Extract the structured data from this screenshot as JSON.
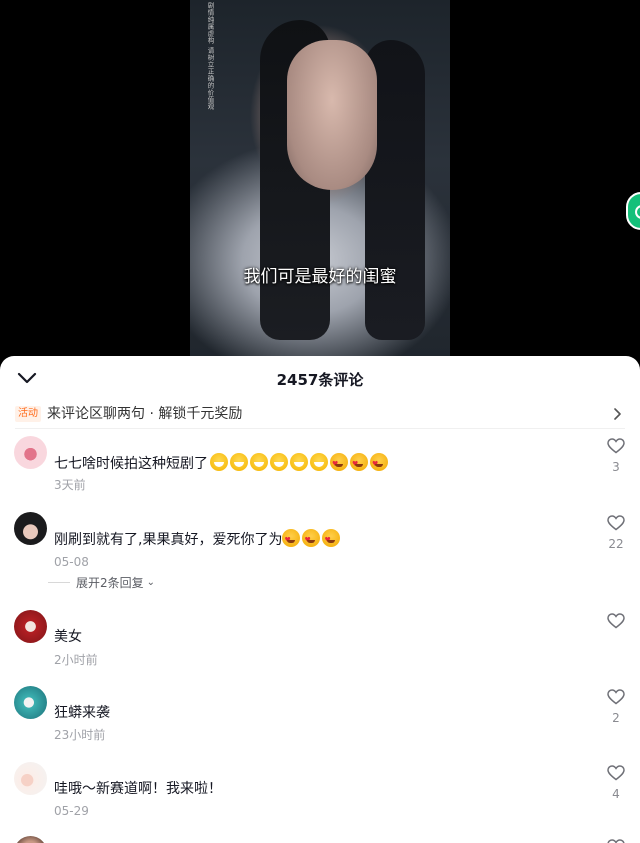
{
  "video": {
    "disclaimer": "剧情纯属虚构 请树立正确的价值观",
    "subtitle": "我们可是最好的闺蜜"
  },
  "sheet": {
    "count_title": "2457条评论",
    "promo": {
      "badge": "活动",
      "text": "来评论区聊两句 · 解锁千元奖励"
    }
  },
  "comments": [
    {
      "text": "七七啥时候拍这种短剧了",
      "emojis": [
        "laugh",
        "laugh",
        "laugh",
        "laugh",
        "laugh",
        "laugh",
        "love",
        "love",
        "love"
      ],
      "time": "3天前",
      "likes": "3"
    },
    {
      "text": "刚刷到就有了,果果真好，爱死你了为",
      "emojis": [
        "love",
        "love",
        "love"
      ],
      "time": "05-08",
      "likes": "22",
      "replies": "展开2条回复"
    },
    {
      "text": "美女",
      "time": "2小时前",
      "likes": ""
    },
    {
      "text": "狂蟒来袭",
      "time": "23小时前",
      "likes": "2"
    },
    {
      "text": "哇哦～新赛道啊！我来啦！",
      "time": "05-29",
      "likes": "4"
    }
  ],
  "icons": [
    "collapse-chevron-icon",
    "right-arrow-icon",
    "heart-icon"
  ],
  "colors": {
    "accent": "#ff6a1a",
    "side_button": "#14c07a"
  }
}
